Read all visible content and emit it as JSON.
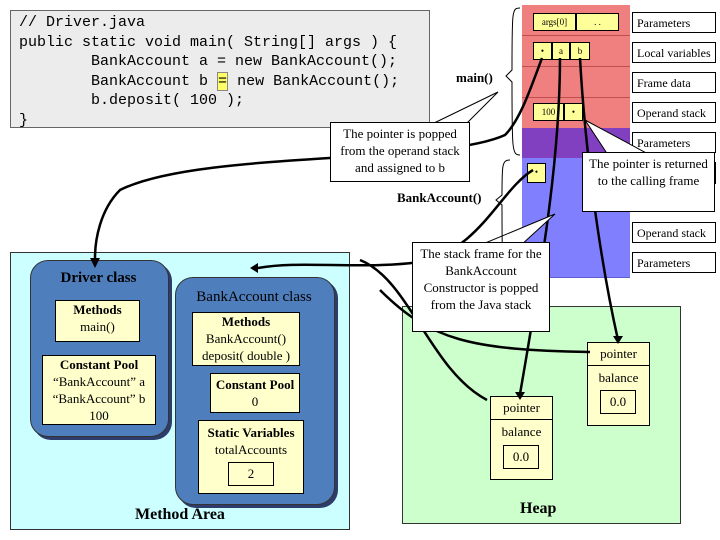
{
  "code": {
    "lines": [
      "// Driver.java",
      "public static void main( String[] args ) {",
      "        BankAccount a = new BankAccount();",
      "        BankAccount b ",
      "new BankAccount();",
      "        b.deposit( 100 );",
      "}"
    ],
    "highlight": "="
  },
  "stack": {
    "frames": {
      "main": "main()",
      "ctor": "BankAccount()"
    },
    "cells": {
      "args0": "args[0]",
      "dots": ". .",
      "ptr": "•",
      "a": "a",
      "b": "b",
      "hundred": "100"
    },
    "labels": [
      "Parameters",
      "Local variables",
      "Frame data",
      "Operand stack",
      "Parameters",
      "Operand stack",
      "Parameters"
    ]
  },
  "callouts": {
    "popped": "The pointer is popped from the operand stack and assigned to b",
    "returned": "The pointer is returned to the calling frame",
    "frame_popped": "The stack frame for the BankAccount Constructor is popped from the Java stack"
  },
  "method_area": {
    "title": "Method Area",
    "driver": {
      "title": "Driver class",
      "methods_title": "Methods",
      "methods": "main()",
      "pool_title": "Constant Pool",
      "pool": [
        "“BankAccount” a",
        "“BankAccount” b",
        "100"
      ]
    },
    "bank": {
      "title": "BankAccount class",
      "methods_title": "Methods",
      "methods": [
        "BankAccount()",
        "deposit( double )"
      ],
      "pool_title": "Constant Pool",
      "pool": "0",
      "static_title": "Static Variables",
      "static_name": "totalAccounts",
      "static_value": "2"
    }
  },
  "heap": {
    "title": "Heap",
    "objects": [
      {
        "pointer": "pointer",
        "field": "balance",
        "value": "0.0"
      },
      {
        "pointer": "pointer",
        "field": "balance",
        "value": "0.0"
      }
    ]
  },
  "colors": {
    "frame_main": "#f08080",
    "frame_overlap": "#8040c0",
    "frame_ctor": "#8080ff",
    "method_area": "#ccffff",
    "heap": "#ccffcc",
    "cell": "#ffff99"
  }
}
